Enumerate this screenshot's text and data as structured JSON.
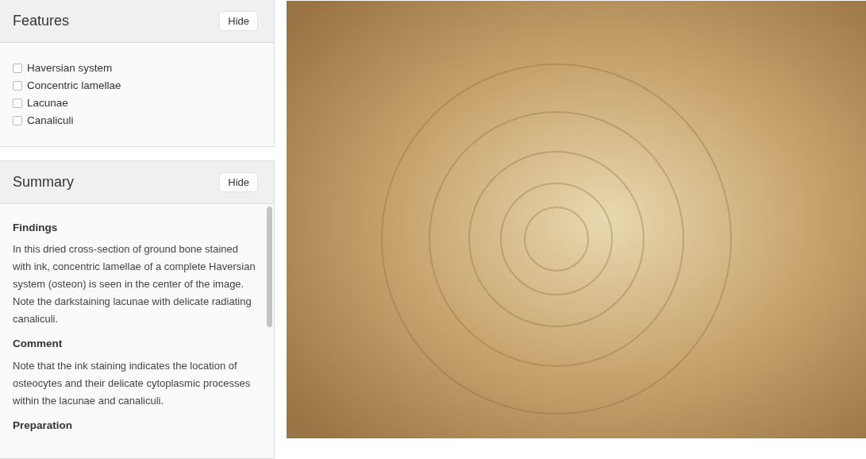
{
  "features": {
    "title": "Features",
    "hide_button": "Hide",
    "items": [
      {
        "label": "Haversian system",
        "checked": false
      },
      {
        "label": "Concentric lamellae",
        "checked": false
      },
      {
        "label": "Lacunae",
        "checked": false
      },
      {
        "label": "Canaliculi",
        "checked": false
      }
    ]
  },
  "summary": {
    "title": "Summary",
    "hide_button": "Hide",
    "sections": [
      {
        "heading": "Findings",
        "text": "In this dried cross-section of ground bone stained with ink, concentric lamellae of a complete Haversian system (osteon) is seen in the center of the image. Note the darkstaining lacunae with delicate radiating canaliculi."
      },
      {
        "heading": "Comment",
        "text": "Note that the ink staining indicates the location of osteocytes and their delicate cytoplasmic processes within the lacunae and canaliculi."
      },
      {
        "heading": "Preparation"
      }
    ]
  }
}
